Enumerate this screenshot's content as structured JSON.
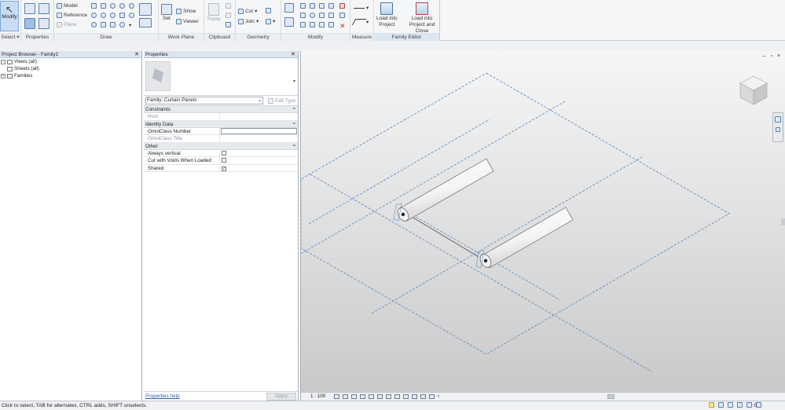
{
  "ribbon": {
    "modify_label": "Modify",
    "select_label": "Select",
    "panels": {
      "properties": "Properties",
      "draw": "Draw",
      "work_plane": "Work Plane",
      "clipboard": "Clipboard",
      "geometry": "Geometry",
      "modify": "Modify",
      "measure": "Measure",
      "family_editor": "Family Editor"
    },
    "draw": {
      "model": "Model",
      "reference": "Reference",
      "plane": "Plane"
    },
    "work_plane": {
      "set": "Set",
      "show": "Show",
      "viewer": "Viewer"
    },
    "clipboard": {
      "paste": "Paste"
    },
    "geometry": {
      "cut": "Cut",
      "join": "Join"
    },
    "family_editor": {
      "load_into_project_1": "Load into",
      "load_into_project_2": "Project",
      "load_close_1": "Load into",
      "load_close_2": "Project and Close"
    }
  },
  "project_browser": {
    "title": "Project Browser - Family2",
    "items": [
      {
        "label": "Views (all)",
        "expander": "−"
      },
      {
        "label": "Sheets (all)",
        "expander": ""
      },
      {
        "label": "Families",
        "expander": "+"
      }
    ]
  },
  "properties": {
    "title": "Properties",
    "family_select": "Family: Curtain Panels",
    "edit_type": "Edit Type",
    "categories": [
      {
        "label": "Constraints",
        "rows": [
          {
            "name": "Host",
            "value": "",
            "kind": "text",
            "dim": true
          }
        ]
      },
      {
        "label": "Identity Data",
        "rows": [
          {
            "name": "OmniClass Number",
            "value": "",
            "kind": "input",
            "dim": false
          },
          {
            "name": "OmniClass Title",
            "value": "",
            "kind": "text",
            "dim": true
          }
        ]
      },
      {
        "label": "Other",
        "rows": [
          {
            "name": "Always vertical",
            "checked": false,
            "kind": "check"
          },
          {
            "name": "Cut with Voids When Loaded",
            "checked": false,
            "kind": "check"
          },
          {
            "name": "Shared",
            "checked": true,
            "kind": "check"
          }
        ]
      }
    ],
    "help_link": "Properties help",
    "apply": "Apply"
  },
  "viewport": {
    "scale": "1 : 100",
    "window_controls": "– ▫ ×"
  },
  "status_bar": {
    "text": "Click to select, TAB for alternates, CTRL adds, SHIFT unselects.",
    "filter_count": ":0"
  },
  "colors": {
    "ribbon_bg": "#f5f6f7",
    "pane_title_bg": "#dde5f0",
    "ref_plane_blue": "#5b8fc7",
    "selected_modify": "#c9ddf2"
  }
}
